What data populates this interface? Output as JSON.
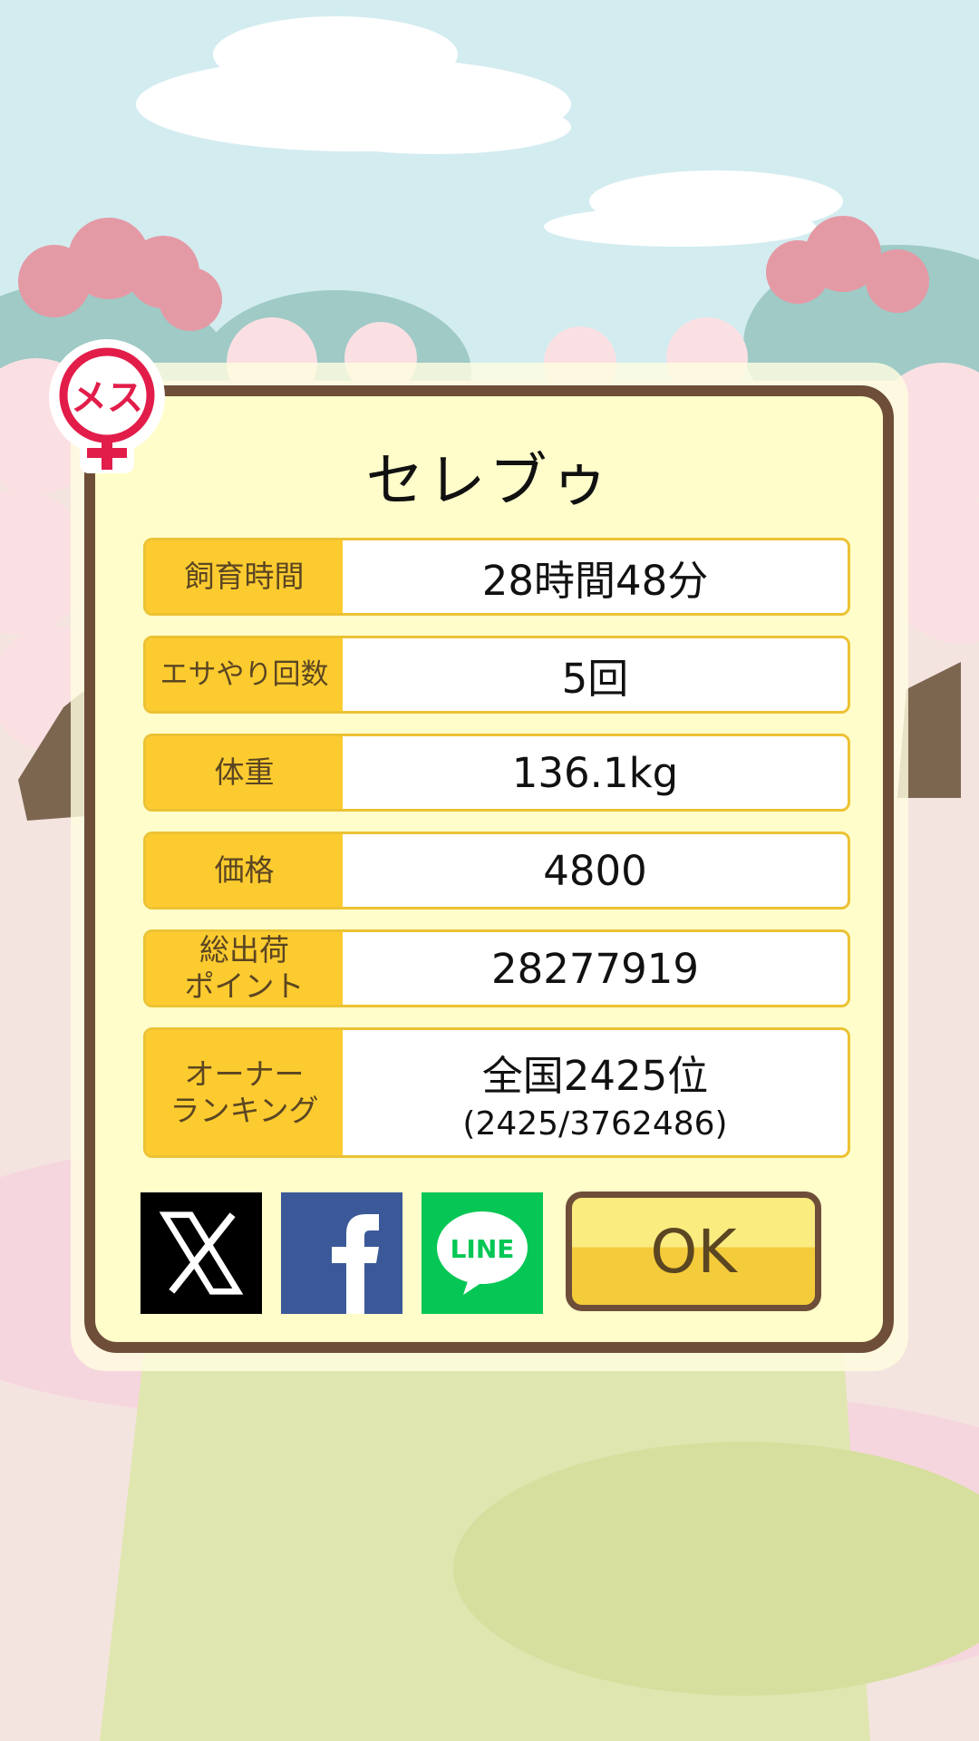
{
  "dialog": {
    "title": "セレブゥ",
    "gender_badge": "メス",
    "stats": [
      {
        "label": "飼育時間",
        "value": "28時間48分"
      },
      {
        "label": "エサやり回数",
        "value": "5回"
      },
      {
        "label": "体重",
        "value": "136.1kg"
      },
      {
        "label": "価格",
        "value": "4800"
      },
      {
        "label": "総出荷\nポイント",
        "value": "28277919"
      }
    ],
    "ranking": {
      "label": "オーナー\nランキング",
      "value": "全国2425位",
      "detail": "(2425/3762486)"
    },
    "share": {
      "x_icon": "x-logo-icon",
      "facebook_icon": "facebook-logo-icon",
      "line_label": "LINE"
    },
    "ok_label": "OK"
  },
  "colors": {
    "frame": "#6e4e38",
    "panel": "#fffdca",
    "label_bg": "#fccb2f",
    "ok_button": "#f4cb3a",
    "line_green": "#06c755",
    "facebook_blue": "#3b5998"
  }
}
